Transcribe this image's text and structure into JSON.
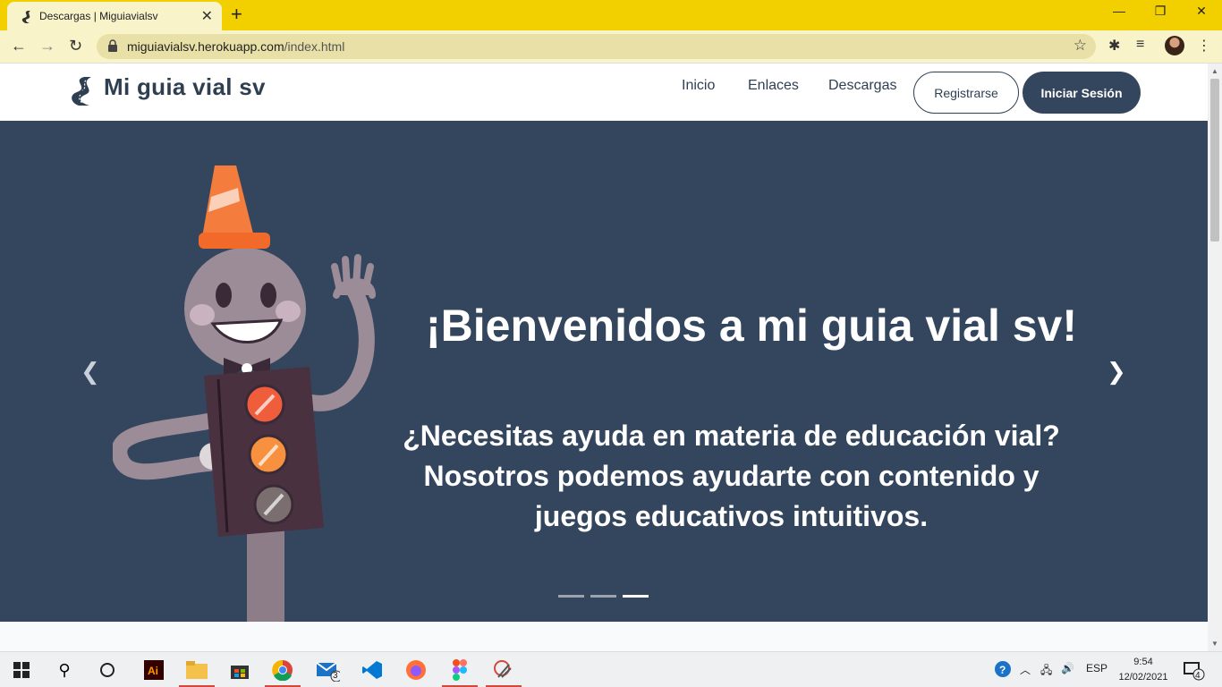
{
  "browser": {
    "tab_title": "Descargas | Miguiavialsv",
    "url_host": "miguiavialsv.herokuapp.com",
    "url_path": "/index.html",
    "accent_color": "#f2d000"
  },
  "site": {
    "brand": "Mi guia vial sv",
    "nav": {
      "inicio": "Inicio",
      "enlaces": "Enlaces",
      "descargas": "Descargas"
    },
    "register_label": "Registrarse",
    "login_label": "Iniciar Sesión",
    "primary_color": "#34465e"
  },
  "hero": {
    "title": "¡Bienvenidos a mi guia vial sv!",
    "line1": "¿Necesitas ayuda en materia de educación vial?",
    "line2": "Nosotros podemos ayudarte con contenido  y",
    "line3": "juegos educativos intuitivos.",
    "active_slide": 3,
    "slide_count": 3
  },
  "taskbar": {
    "mail_badge": "3",
    "lang": "ESP",
    "time": "9:54",
    "date": "12/02/2021",
    "notifications": "4"
  }
}
